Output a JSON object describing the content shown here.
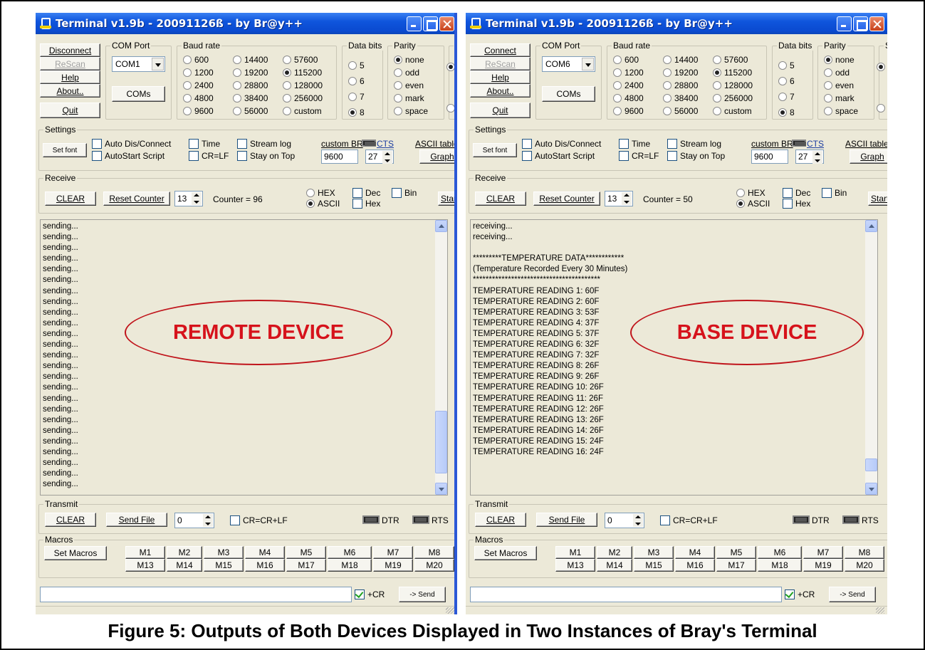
{
  "caption": "Figure 5: Outputs of Both Devices Displayed in Two Instances of Bray's Terminal",
  "colors": {
    "title_bar": "#0a4ad0",
    "window_bg": "#ece9d8",
    "oval_red": "#d6121b"
  },
  "common": {
    "rescan": "ReScan",
    "help": "Help",
    "about": "About..",
    "quit": "Quit",
    "com_port_group": "COM Port",
    "coms": "COMs",
    "baud_group": "Baud rate",
    "baud_options": [
      "600",
      "1200",
      "2400",
      "4800",
      "9600",
      "14400",
      "19200",
      "28800",
      "38400",
      "56000",
      "57600",
      "115200",
      "128000",
      "256000",
      "custom"
    ],
    "baud_selected": "115200",
    "databits_group": "Data bits",
    "databits_options": [
      "5",
      "6",
      "7",
      "8"
    ],
    "databits_selected": "8",
    "parity_group": "Parity",
    "parity_options": [
      "none",
      "odd",
      "even",
      "mark",
      "space"
    ],
    "parity_selected": "none",
    "stop_group": "S",
    "settings_group": "Settings",
    "set_font": "Set font",
    "auto_dis_connect": "Auto Dis/Connect",
    "autostart_script": "AutoStart Script",
    "time": "Time",
    "cr_lf": "CR=LF",
    "stream_log": "Stream log",
    "stay_on_top": "Stay on Top",
    "custom_br": "custom BR",
    "custom_br_value": "9600",
    "rx_clear_value": "27",
    "cts": "CTS",
    "ascii_table": "ASCII table",
    "graph": "Graph",
    "receive_group": "Receive",
    "clear": "CLEAR",
    "reset_counter": "Reset Counter",
    "counter_spin": "13",
    "hex": "HEX",
    "ascii": "ASCII",
    "dec": "Dec",
    "hex_lower": "Hex",
    "bin": "Bin",
    "start_log": "StartL",
    "transmit_group": "Transmit",
    "send_file": "Send File",
    "transmit_spin": "0",
    "cr_crlf": "CR=CR+LF",
    "dtr": "DTR",
    "rts": "RTS",
    "macros_group": "Macros",
    "set_macros": "Set Macros",
    "macros_row1": [
      "M1",
      "M2",
      "M3",
      "M4",
      "M5",
      "M6",
      "M7",
      "M8"
    ],
    "macros_row2": [
      "M13",
      "M14",
      "M15",
      "M16",
      "M17",
      "M18",
      "M19",
      "M20"
    ],
    "plus_cr": "+CR",
    "send": "-> Send"
  },
  "left": {
    "title": "Terminal v1.9b - 20091126ß - by Br@y++",
    "connect_button": "Disconnect",
    "com_port": "COM1",
    "counter": "Counter = 96",
    "oval_label": "REMOTE DEVICE",
    "log_lines": [
      "sending...",
      "sending...",
      "sending...",
      "sending...",
      "sending...",
      "sending...",
      "sending...",
      "sending...",
      "sending...",
      "sending...",
      "sending...",
      "sending...",
      "sending...",
      "sending...",
      "sending...",
      "sending...",
      "sending...",
      "sending...",
      "sending...",
      "sending...",
      "sending...",
      "sending...",
      "sending...",
      "sending...",
      "sending..."
    ]
  },
  "right": {
    "title": "Terminal v1.9b - 20091126ß - by Br@y++",
    "connect_button": "Connect",
    "com_port": "COM6",
    "counter": "Counter = 50",
    "oval_label": "BASE DEVICE",
    "log_lines": [
      "receiving...",
      "receiving...",
      "",
      "*********TEMPERATURE DATA************",
      "(Temperature Recorded Every 30 Minutes)",
      "****************************************",
      "TEMPERATURE READING 1: 60F",
      "TEMPERATURE READING 2: 60F",
      "TEMPERATURE READING 3: 53F",
      "TEMPERATURE READING 4: 37F",
      "TEMPERATURE READING 5: 37F",
      "TEMPERATURE READING 6: 32F",
      "TEMPERATURE READING 7: 32F",
      "TEMPERATURE READING 8: 26F",
      "TEMPERATURE READING 9: 26F",
      "TEMPERATURE READING 10: 26F",
      "TEMPERATURE READING 11: 26F",
      "TEMPERATURE READING 12: 26F",
      "TEMPERATURE READING 13: 26F",
      "TEMPERATURE READING 14: 26F",
      "TEMPERATURE READING 15: 24F",
      "TEMPERATURE READING 16: 24F"
    ]
  }
}
